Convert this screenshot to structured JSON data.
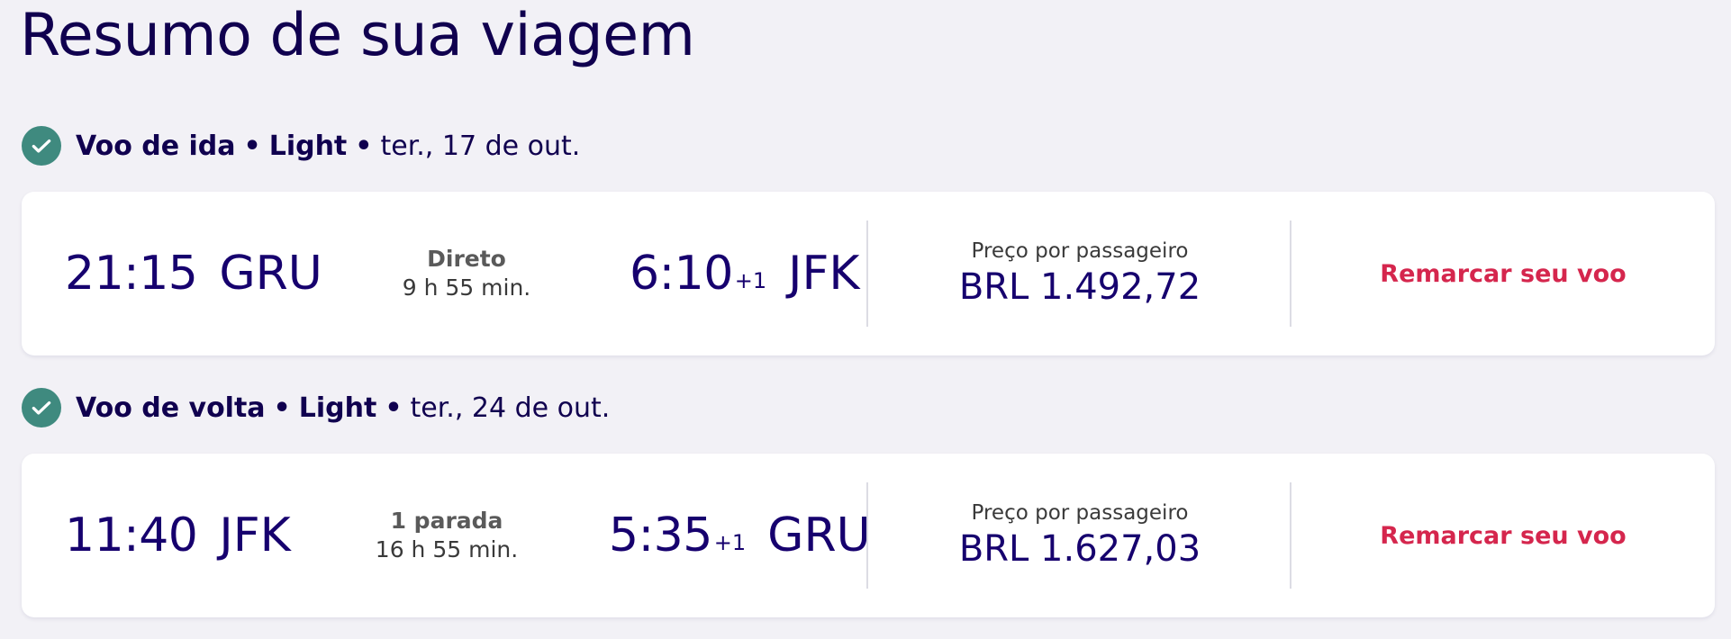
{
  "page": {
    "title": "Resumo de sua viagem"
  },
  "colors": {
    "primary": "#10004f",
    "check": "#3f8a7f",
    "action": "#d5264d",
    "background": "#f2f1f6"
  },
  "icons": {
    "check": "check-circle-icon"
  },
  "outbound": {
    "header": {
      "direction": "Voo de ida",
      "fare": "Light",
      "date": "ter., 17 de out.",
      "separator": "•"
    },
    "departure": {
      "time": "21:15",
      "airport": "GRU"
    },
    "stops": {
      "label": "Direto",
      "duration": "9 h 55 min."
    },
    "arrival": {
      "time": "6:10",
      "day_offset": "+1",
      "airport": "JFK"
    },
    "price": {
      "label": "Preço por passageiro",
      "value": "BRL 1.492,72"
    },
    "action_label": "Remarcar seu voo"
  },
  "return": {
    "header": {
      "direction": "Voo de volta",
      "fare": "Light",
      "date": "ter., 24 de out.",
      "separator": "•"
    },
    "departure": {
      "time": "11:40",
      "airport": "JFK"
    },
    "stops": {
      "label": "1 parada",
      "duration": "16 h 55 min."
    },
    "arrival": {
      "time": "5:35",
      "day_offset": "+1",
      "airport": "GRU"
    },
    "price": {
      "label": "Preço por passageiro",
      "value": "BRL 1.627,03"
    },
    "action_label": "Remarcar seu voo"
  }
}
